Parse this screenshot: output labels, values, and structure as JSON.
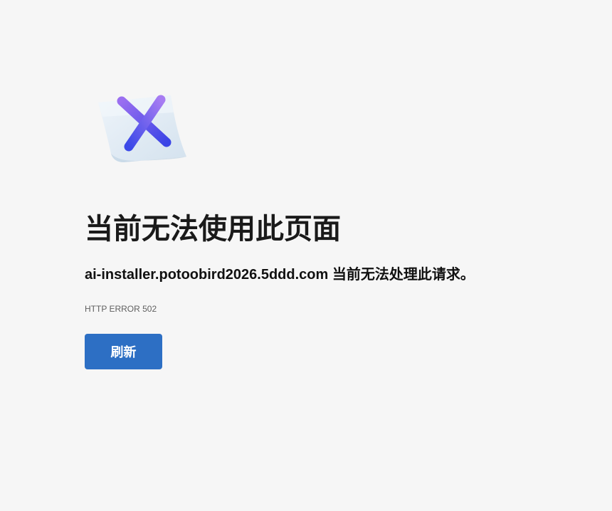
{
  "illustration": {
    "icon": "broken-page-x-icon"
  },
  "heading": "当前无法使用此页面",
  "message": {
    "host": "ai-installer.potoobird2026.5ddd.com",
    "text": " 当前无法处理此请求。"
  },
  "error_code": "HTTP ERROR 502",
  "buttons": {
    "refresh_label": "刷新"
  },
  "colors": {
    "background": "#f6f6f6",
    "button": "#2d6fc4"
  }
}
